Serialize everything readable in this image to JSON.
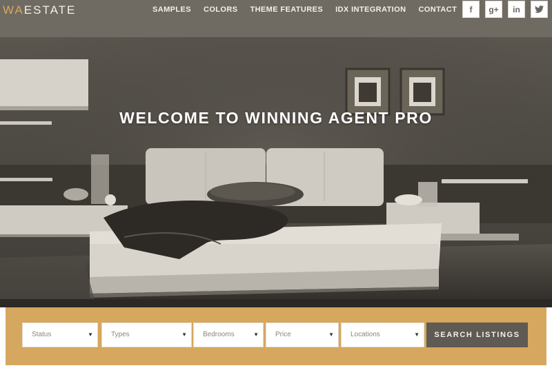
{
  "header": {
    "logo_accent": "WA",
    "logo_rest": "ESTATE",
    "nav": [
      "SAMPLES",
      "COLORS",
      "THEME FEATURES",
      "IDX INTEGRATION",
      "CONTACT"
    ],
    "social": [
      {
        "glyph": "f",
        "icon": "facebook-icon"
      },
      {
        "glyph": "g+",
        "icon": "google-plus-icon"
      },
      {
        "glyph": "in",
        "icon": "linkedin-icon"
      },
      {
        "glyph": "🐦",
        "icon": "twitter-icon"
      }
    ]
  },
  "hero": {
    "title": "WELCOME TO WINNING AGENT PRO"
  },
  "search": {
    "fields": [
      {
        "label": "Status"
      },
      {
        "label": "Types"
      },
      {
        "label": "Bedrooms"
      },
      {
        "label": "Price"
      },
      {
        "label": "Locations"
      }
    ],
    "button_label": "SEARCH LISTINGS"
  },
  "colors": {
    "header_bg": "#6f6a62",
    "accent_gold": "#d6a75f",
    "button_bg": "#5f5a54"
  }
}
